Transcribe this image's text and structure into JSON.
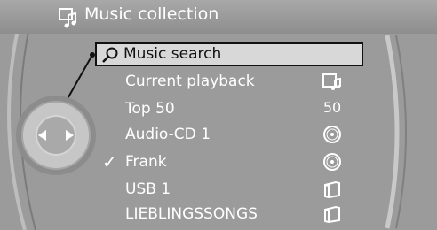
{
  "header": {
    "title": "Music collection",
    "icon": "music-note-settings-icon"
  },
  "menu": {
    "items": [
      {
        "label": "Music search",
        "selected": true,
        "icon": "search-icon",
        "right_icon": ""
      },
      {
        "label": "Current playback",
        "selected": false,
        "right_icon": "now-playing-icon"
      },
      {
        "label": "Top 50",
        "selected": false,
        "right_text": "50"
      },
      {
        "label": "Audio-CD 1",
        "selected": false,
        "right_icon": "cd-icon"
      },
      {
        "label": "Frank",
        "selected": false,
        "checked": true,
        "check_mark": "✓",
        "right_icon": "cd-icon"
      },
      {
        "label": "USB 1",
        "selected": false,
        "right_icon": "folder-icon"
      },
      {
        "label": "LIEBLINGSSONGS",
        "selected": false,
        "right_icon": "folder-icon"
      }
    ]
  },
  "colors": {
    "background": "#9b9b9b",
    "text": "#ffffff",
    "highlight_bg": "#d8d8d8",
    "highlight_border": "#111111"
  }
}
